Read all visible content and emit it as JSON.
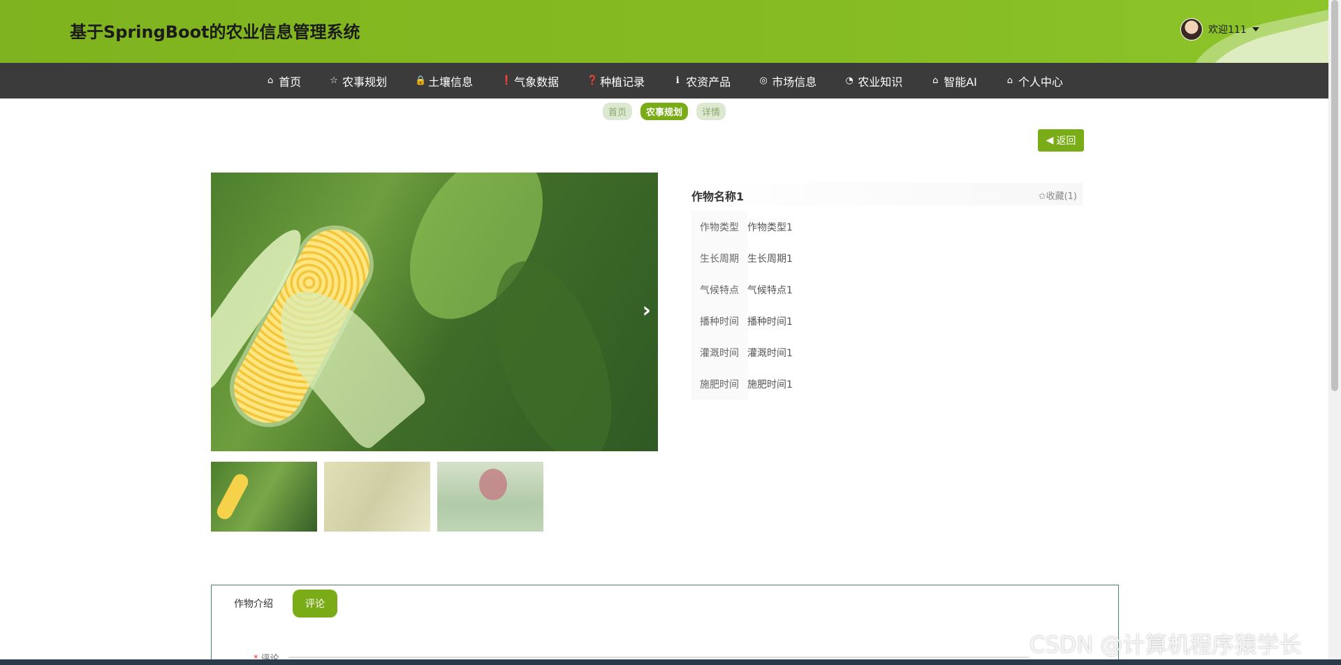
{
  "header": {
    "title": "基于SpringBoot的农业信息管理系统",
    "welcome": "欢迎111"
  },
  "nav": {
    "items": [
      {
        "icon": "⌂",
        "label": "首页"
      },
      {
        "icon": "☆",
        "label": "农事规划"
      },
      {
        "icon": "🔒",
        "label": "土壤信息"
      },
      {
        "icon": "❗",
        "label": "气象数据"
      },
      {
        "icon": "❓",
        "label": "种植记录"
      },
      {
        "icon": "ℹ",
        "label": "农资产品"
      },
      {
        "icon": "◎",
        "label": "市场信息"
      },
      {
        "icon": "◔",
        "label": "农业知识"
      },
      {
        "icon": "⌂",
        "label": "智能AI"
      },
      {
        "icon": "⌂",
        "label": "个人中心"
      }
    ]
  },
  "breadcrumb": [
    "首页",
    "农事规划",
    "详情"
  ],
  "back_label": "返回",
  "detail": {
    "title": "作物名称1",
    "favorite": "✩收藏(1)",
    "rows": [
      {
        "key": "作物类型",
        "value": "作物类型1"
      },
      {
        "key": "生长周期",
        "value": "生长周期1"
      },
      {
        "key": "气候特点",
        "value": "气候特点1"
      },
      {
        "key": "播种时间",
        "value": "播种时间1"
      },
      {
        "key": "灌溉时间",
        "value": "灌溉时间1"
      },
      {
        "key": "施肥时间",
        "value": "施肥时间1"
      }
    ]
  },
  "tabs": [
    "作物介绍",
    "评论"
  ],
  "comment_label": "评论",
  "watermark": "CSDN @计算机程序猿学长"
}
